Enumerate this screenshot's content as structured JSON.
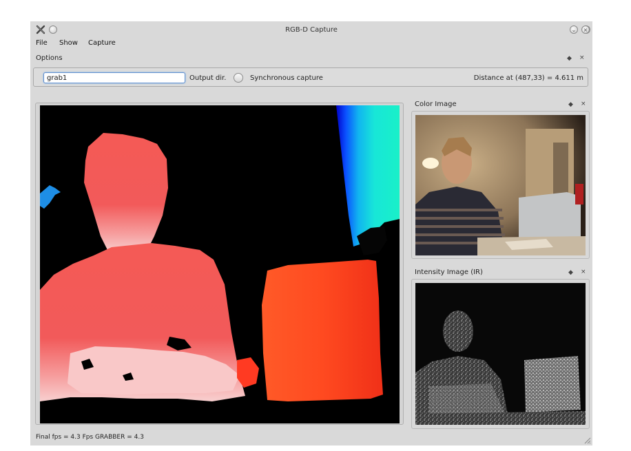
{
  "window": {
    "title": "RGB-D Capture",
    "controls": [
      "minimize-icon",
      "maximize-icon",
      "close-icon"
    ]
  },
  "menu": {
    "items": [
      "File",
      "Show",
      "Capture"
    ]
  },
  "options_dock": {
    "title": "Options",
    "float_symbol": "◆",
    "close_symbol": "×"
  },
  "options": {
    "name_value": "grab1",
    "output_dir_label": "Output dir.",
    "sync_capture_label": "Synchronous capture",
    "sync_capture_checked": false,
    "distance_text": "Distance at (487,33) = 4.611 m"
  },
  "color_dock": {
    "title": "Color Image",
    "float_symbol": "◆",
    "close_symbol": "×"
  },
  "ir_dock": {
    "title": "Intensity Image (IR)",
    "float_symbol": "◆",
    "close_symbol": "×"
  },
  "status": {
    "text": "Final fps = 4.3 Fps GRABBER = 4.3"
  },
  "colors": {
    "window_bg": "#d9d9d9",
    "input_focus_border": "#5f8fcf"
  }
}
